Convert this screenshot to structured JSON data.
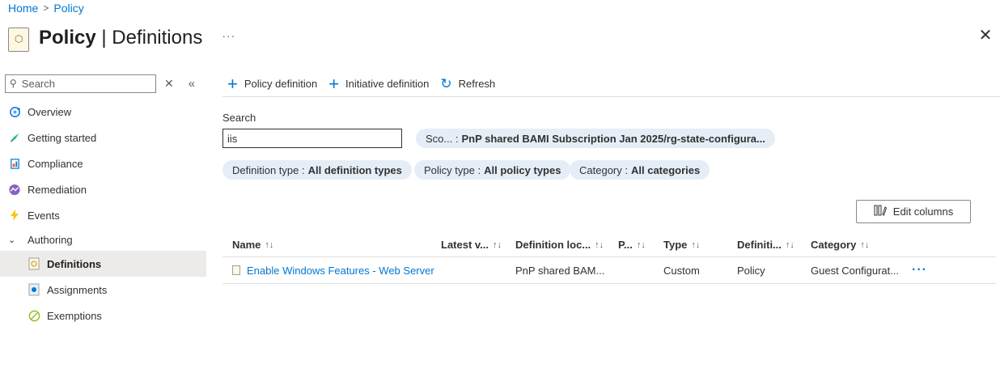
{
  "breadcrumb": {
    "home": "Home",
    "separator": ">",
    "current": "Policy"
  },
  "header": {
    "title_bold": "Policy",
    "title_rest": " | Definitions",
    "more": "···",
    "close": "✕"
  },
  "sidebar": {
    "search_placeholder": "Search",
    "items": [
      {
        "label": "Overview"
      },
      {
        "label": "Getting started"
      },
      {
        "label": "Compliance"
      },
      {
        "label": "Remediation"
      },
      {
        "label": "Events"
      },
      {
        "label": "Authoring"
      },
      {
        "label": "Definitions"
      },
      {
        "label": "Assignments"
      },
      {
        "label": "Exemptions"
      }
    ]
  },
  "toolbar": {
    "policy_definition": "Policy definition",
    "initiative_definition": "Initiative definition",
    "refresh": "Refresh"
  },
  "search": {
    "label": "Search",
    "value": "iis"
  },
  "filters": {
    "scope": {
      "key": "Sco... :",
      "value": "PnP shared BAMI Subscription Jan 2025/rg-state-configura..."
    },
    "definition_type": {
      "key": "Definition type :",
      "value": "All definition types"
    },
    "policy_type": {
      "key": "Policy type :",
      "value": "All policy types"
    },
    "category": {
      "key": "Category :",
      "value": "All categories"
    }
  },
  "edit_columns": "Edit columns",
  "table": {
    "columns": [
      "Name",
      "Latest v...",
      "Definition loc...",
      "P...",
      "Type",
      "Definiti...",
      "Category"
    ],
    "sort_glyph": "↑↓",
    "rows": [
      {
        "name": "Enable Windows Features - Web Server",
        "latest_version": "",
        "definition_location": "PnP shared BAM...",
        "p": "",
        "type": "Custom",
        "definition_type": "Policy",
        "category": "Guest Configurat...",
        "more": "···"
      }
    ]
  },
  "colors": {
    "accent": "#0078d4",
    "selected_bg": "#edebe9",
    "pill_bg": "#e5eef7"
  }
}
